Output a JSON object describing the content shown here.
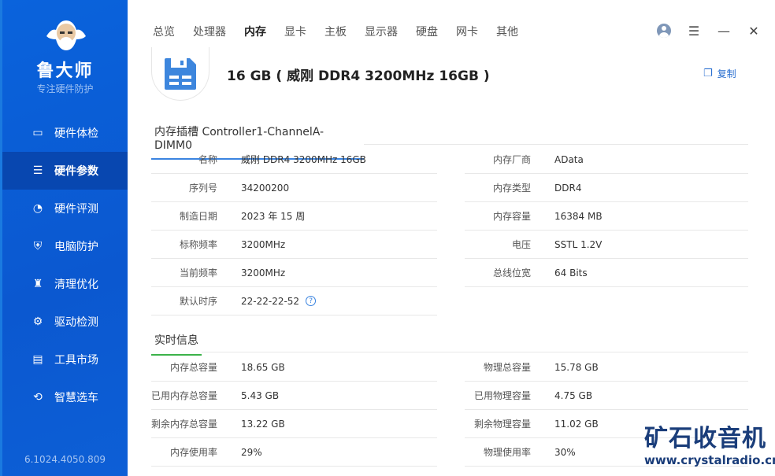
{
  "sidebar": {
    "brand": "鲁大师",
    "slogan": "专注硬件防护",
    "version": "6.1024.4050.809",
    "items": [
      {
        "label": "硬件体检",
        "icon": "monitor-icon"
      },
      {
        "label": "硬件参数",
        "icon": "sliders-icon"
      },
      {
        "label": "硬件评测",
        "icon": "gauge-icon"
      },
      {
        "label": "电脑防护",
        "icon": "shield-icon"
      },
      {
        "label": "清理优化",
        "icon": "broom-icon"
      },
      {
        "label": "驱动检测",
        "icon": "gear-icon"
      },
      {
        "label": "工具市场",
        "icon": "toolbox-icon"
      },
      {
        "label": "智慧选车",
        "icon": "car-icon"
      }
    ]
  },
  "tabs": [
    "总览",
    "处理器",
    "内存",
    "显卡",
    "主板",
    "显示器",
    "硬盘",
    "网卡",
    "其他"
  ],
  "active_tab": "内存",
  "header": {
    "title": "16 GB ( 威刚 DDR4 3200MHz 16GB )",
    "copy": "复制"
  },
  "slot": {
    "tab": "内存插槽 Controller1-ChannelA-DIMM0",
    "left": [
      [
        "名称",
        "威刚 DDR4 3200MHz 16GB"
      ],
      [
        "序列号",
        "34200200"
      ],
      [
        "制造日期",
        "2023 年 15 周"
      ],
      [
        "标称频率",
        "3200MHz"
      ],
      [
        "当前频率",
        "3200MHz"
      ],
      [
        "默认时序",
        "22-22-22-52"
      ]
    ],
    "right": [
      [
        "内存厂商",
        "AData"
      ],
      [
        "内存类型",
        "DDR4"
      ],
      [
        "内存容量",
        "16384 MB"
      ],
      [
        "电压",
        "SSTL 1.2V"
      ],
      [
        "总线位宽",
        "64 Bits"
      ]
    ]
  },
  "realtime": {
    "tab": "实时信息",
    "left": [
      [
        "内存总容量",
        "18.65 GB"
      ],
      [
        "已用内存总容量",
        "5.43 GB"
      ],
      [
        "剩余内存总容量",
        "13.22 GB"
      ],
      [
        "内存使用率",
        "29%"
      ]
    ],
    "right": [
      [
        "物理总容量",
        "15.78 GB"
      ],
      [
        "已用物理容量",
        "4.75 GB"
      ],
      [
        "剩余物理容量",
        "11.02 GB"
      ],
      [
        "物理使用率",
        "30%"
      ]
    ]
  },
  "watermark": {
    "cn": "矿石收音机",
    "url": "www.crystalradio.cn"
  },
  "colors": {
    "sidebar": "#0b58d0",
    "active": "#0847b0",
    "accent": "#3b84e0",
    "green": "#3cb34a"
  }
}
